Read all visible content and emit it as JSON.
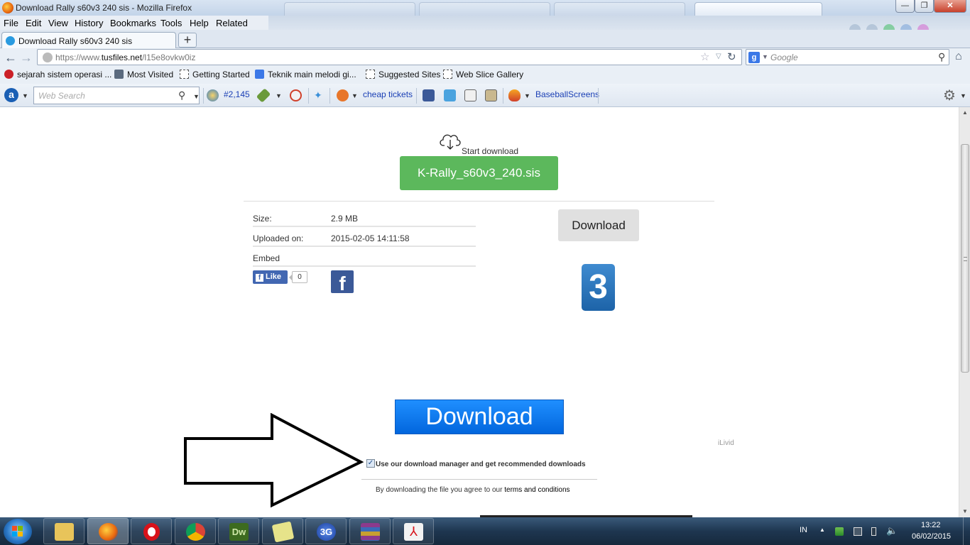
{
  "window": {
    "title": "Download Rally s60v3 240 sis - Mozilla Firefox",
    "controls": {
      "minimize": "—",
      "maximize": "❐",
      "close": "✕"
    }
  },
  "menu": {
    "items": [
      {
        "label": "File"
      },
      {
        "label": "Edit"
      },
      {
        "label": "View"
      },
      {
        "label": "History"
      },
      {
        "label": "Bookmarks"
      },
      {
        "label": "Tools"
      },
      {
        "label": "Help"
      },
      {
        "label": "Related Links"
      }
    ]
  },
  "tabs": {
    "active_label": "Download Rally s60v3 240 sis",
    "new_tab": "+"
  },
  "nav": {
    "url_prefix": "https://www.",
    "url_domain": "tusfiles.net",
    "url_path": "/l15e8ovkw0iz",
    "search_placeholder": "Google"
  },
  "bookmarks": [
    {
      "label": "sejarah sistem operasi ...",
      "icon": "pinterest-icon"
    },
    {
      "label": "Most Visited",
      "icon": "folder-icon"
    },
    {
      "label": "Getting Started",
      "icon": "page-icon"
    },
    {
      "label": "Teknik main melodi gi...",
      "icon": "google-icon"
    },
    {
      "label": "Suggested Sites",
      "icon": "page-icon"
    },
    {
      "label": "Web Slice Gallery",
      "icon": "page-icon"
    }
  ],
  "toolbar": {
    "search_placeholder": "Web Search",
    "rank": "#2,145",
    "cheap_tickets": "cheap tickets",
    "baseball": "BaseballScreens"
  },
  "page": {
    "start_download": "Start download",
    "file_button": "K-Rally_s60v3_240.sis",
    "info": [
      {
        "key": "Size:",
        "value": "2.9 MB"
      },
      {
        "key": "Uploaded on:",
        "value": "2015-02-05 14:11:58"
      },
      {
        "key": "Embed",
        "value": ""
      }
    ],
    "fb_like": "Like",
    "fb_count": "0",
    "download_button": "Download",
    "badge_number": "3",
    "big_download": "Download",
    "ad_label": "iLivid",
    "checkbox_label": "Use our download manager and get recommended downloads",
    "terms_prefix": "By downloading the file you agree to our",
    "terms_link": "terms and conditions"
  },
  "taskbar": {
    "lang": "IN",
    "time": "13:22",
    "date": "06/02/2015",
    "apps": [
      {
        "name": "explorer",
        "color": "#e8c45a"
      },
      {
        "name": "firefox",
        "color": "#e8660e"
      },
      {
        "name": "opera",
        "color": "#d8121a"
      },
      {
        "name": "chrome",
        "color": "#3aa757"
      },
      {
        "name": "dreamweaver",
        "color": "#3d6b1f",
        "text": "Dw"
      },
      {
        "name": "sticky-notes",
        "color": "#e6e38a"
      },
      {
        "name": "3g-modem",
        "color": "#2a5bb8",
        "text": "3G"
      },
      {
        "name": "winrar",
        "color": "#8c3a8c"
      },
      {
        "name": "acrobat",
        "color": "#e8e8e8"
      }
    ]
  }
}
